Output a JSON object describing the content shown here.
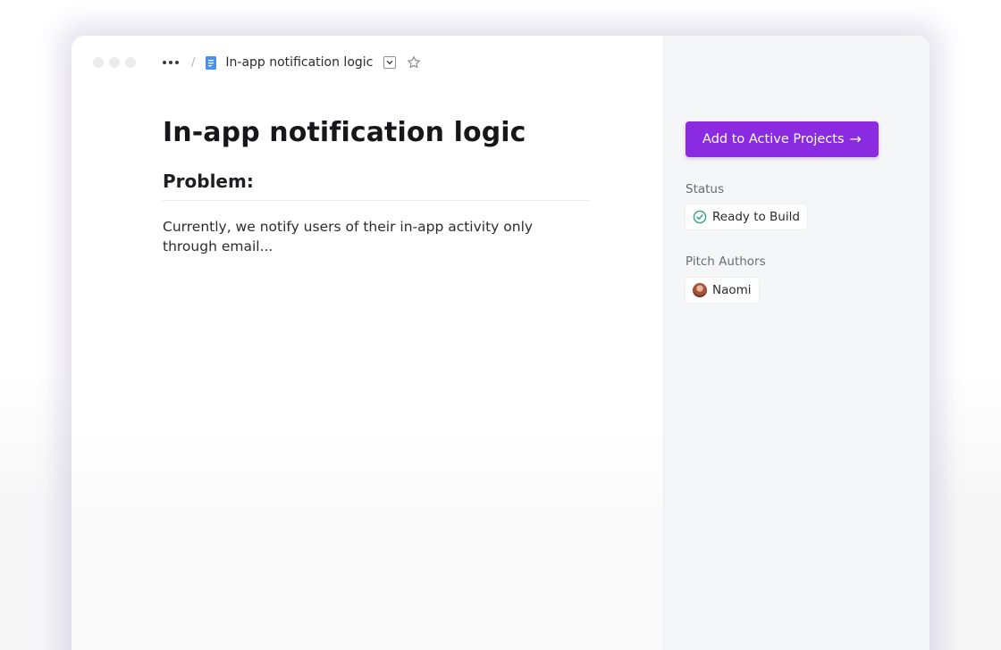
{
  "breadcrumb": {
    "separator": "/",
    "title": "In-app notification logic"
  },
  "document": {
    "title": "In-app notification logic",
    "section_heading": "Problem:",
    "body": "Currently, we notify users of their in-app activity only through email..."
  },
  "sidebar": {
    "cta_label": "Add to Active Projects",
    "cta_arrow": "→",
    "status_label": "Status",
    "status_value": "Ready to Build",
    "authors_label": "Pitch Authors",
    "author_name": "Naomi"
  },
  "colors": {
    "accent": "#8a2be2",
    "status_green": "#2fa37a",
    "doc_icon_blue": "#4a90f0"
  },
  "icons": {
    "more": "more-horizontal-icon",
    "doc": "document-icon",
    "chevron": "chevron-down-icon",
    "star": "star-icon",
    "check": "check-circle-icon",
    "arrow": "arrow-right-icon"
  }
}
